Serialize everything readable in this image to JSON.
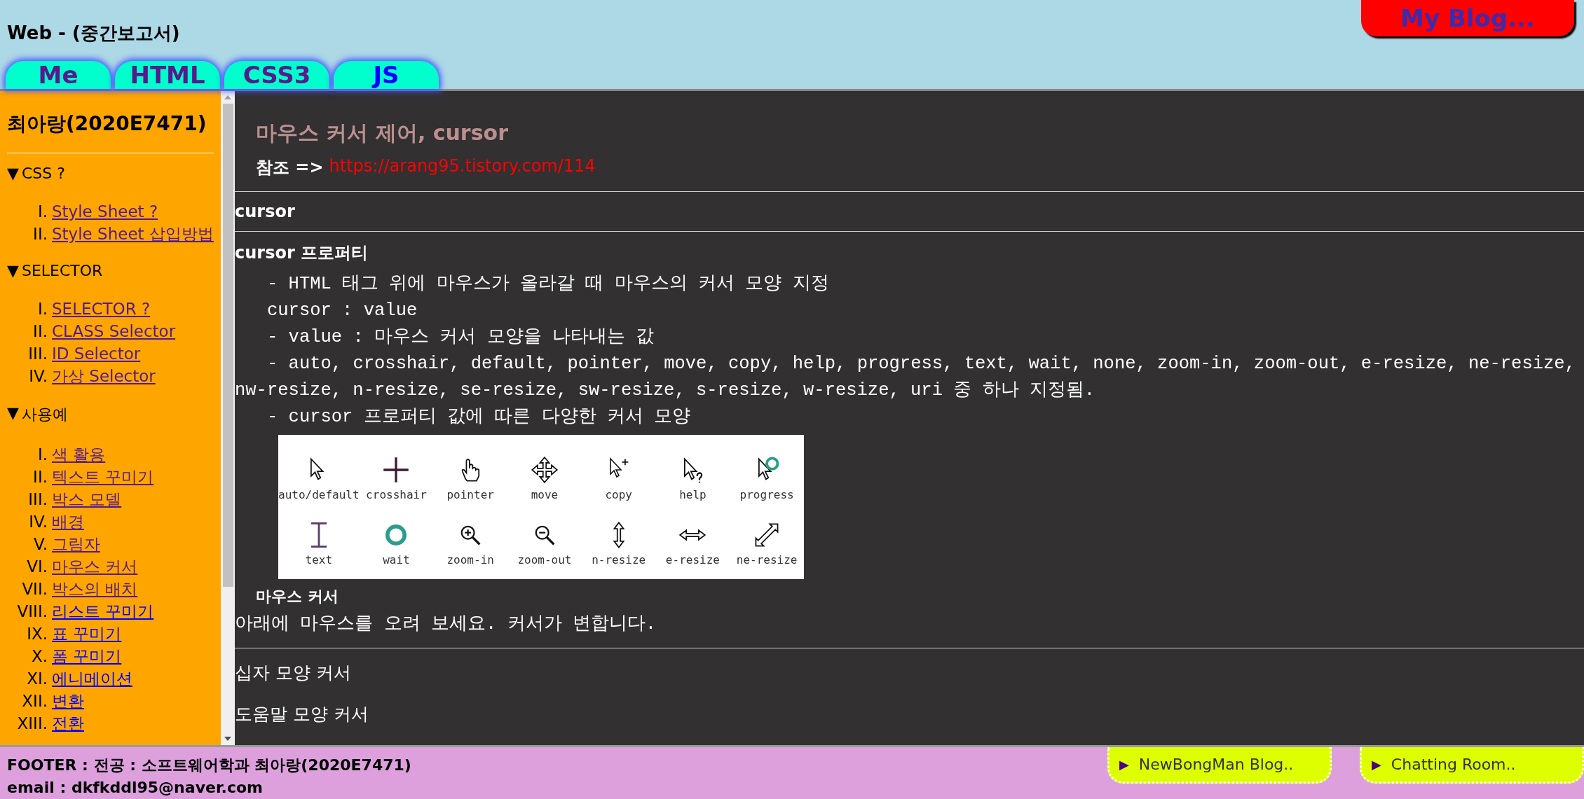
{
  "header": {
    "title": "Web - (중간보고서)",
    "blog_button": "My Blog...",
    "tabs": [
      {
        "label": "Me",
        "visited": true
      },
      {
        "label": "HTML",
        "visited": true
      },
      {
        "label": "CSS3",
        "visited": true
      },
      {
        "label": "JS",
        "visited": false
      }
    ]
  },
  "sidebar": {
    "name": "최아랑(2020E7471)",
    "sections": [
      {
        "title": "CSS ?",
        "marker": "▼",
        "items": [
          {
            "numeral": "I.",
            "label": "Style Sheet ?",
            "visited": true
          },
          {
            "numeral": "II.",
            "label": "Style Sheet 삽입방법",
            "visited": true
          }
        ]
      },
      {
        "title": "SELECTOR",
        "marker": "▼",
        "items": [
          {
            "numeral": "I.",
            "label": "SELECTOR ?",
            "visited": true
          },
          {
            "numeral": "II.",
            "label": "CLASS Selector",
            "visited": true
          },
          {
            "numeral": "III.",
            "label": "ID Selector",
            "visited": true
          },
          {
            "numeral": "IV.",
            "label": "가상 Selector",
            "visited": true
          }
        ]
      },
      {
        "title": "사용예",
        "marker": "▼",
        "items": [
          {
            "numeral": "I.",
            "label": "색 활용",
            "visited": true
          },
          {
            "numeral": "II.",
            "label": "텍스트 꾸미기",
            "visited": true
          },
          {
            "numeral": "III.",
            "label": "박스 모델",
            "visited": true
          },
          {
            "numeral": "IV.",
            "label": "배경",
            "visited": true
          },
          {
            "numeral": "V.",
            "label": "그림자",
            "visited": true
          },
          {
            "numeral": "VI.",
            "label": "마우스 커서",
            "visited": true
          },
          {
            "numeral": "VII.",
            "label": "박스의 배치",
            "visited": true
          },
          {
            "numeral": "VIII.",
            "label": "리스트 꾸미기",
            "visited": false
          },
          {
            "numeral": "IX.",
            "label": "표 꾸미기",
            "visited": false
          },
          {
            "numeral": "X.",
            "label": "폼 꾸미기",
            "visited": false
          },
          {
            "numeral": "XI.",
            "label": "에니메이션",
            "visited": false
          },
          {
            "numeral": "XII.",
            "label": "변환",
            "visited": false
          },
          {
            "numeral": "XIII.",
            "label": "전환",
            "visited": false
          }
        ]
      }
    ]
  },
  "content": {
    "title": "마우스 커서 제어, cursor",
    "reference": {
      "label": "참조 =>",
      "url": "https://arang95.tistory.com/114"
    },
    "section_title": "cursor",
    "property_title": "cursor 프로퍼티",
    "lines": [
      "- HTML 태그 위에 마우스가 올라갈 때 마우스의 커서 모양 지정",
      "cursor : value",
      "- value : 마우스 커서 모양을 나타내는 값",
      "- auto, crosshair, default, pointer, move, copy, help, progress, text, wait, none, zoom-in, zoom-out, e-resize, ne-resize, nw-resize, n-resize, se-resize, sw-resize, s-resize, w-resize, uri 중 하나 지정됨.",
      "- cursor 프로퍼티 값에 따른 다양한 커서 모양"
    ],
    "cursor_table": [
      {
        "kind": "arrow",
        "label": "auto/default"
      },
      {
        "kind": "cross",
        "label": "crosshair"
      },
      {
        "kind": "hand",
        "label": "pointer"
      },
      {
        "kind": "move",
        "label": "move"
      },
      {
        "kind": "copy",
        "label": "copy"
      },
      {
        "kind": "help",
        "label": "help"
      },
      {
        "kind": "progress",
        "label": "progress"
      },
      {
        "kind": "text",
        "label": "text"
      },
      {
        "kind": "wait",
        "label": "wait"
      },
      {
        "kind": "zoomin",
        "label": "zoom-in"
      },
      {
        "kind": "zoomout",
        "label": "zoom-out"
      },
      {
        "kind": "nresize",
        "label": "n-resize"
      },
      {
        "kind": "eresize",
        "label": "e-resize"
      },
      {
        "kind": "neresize",
        "label": "ne-resize"
      }
    ],
    "demo_title": "마우스 커서",
    "demo_text": "아래에 마우스를 오려 보세요. 커서가 변합니다.",
    "demo_items": [
      "십자 모양 커서",
      "도움말 모양 커서"
    ]
  },
  "footer": {
    "lines": [
      "FOOTER : 전공 : 소프트웨어학과 최아랑(2020E7471)",
      "email : dkfkddl95@naver.com"
    ],
    "links": [
      {
        "marker": "▶",
        "label": "NewBongMan Blog.."
      },
      {
        "marker": "▶",
        "label": "Chatting Room.."
      }
    ]
  }
}
